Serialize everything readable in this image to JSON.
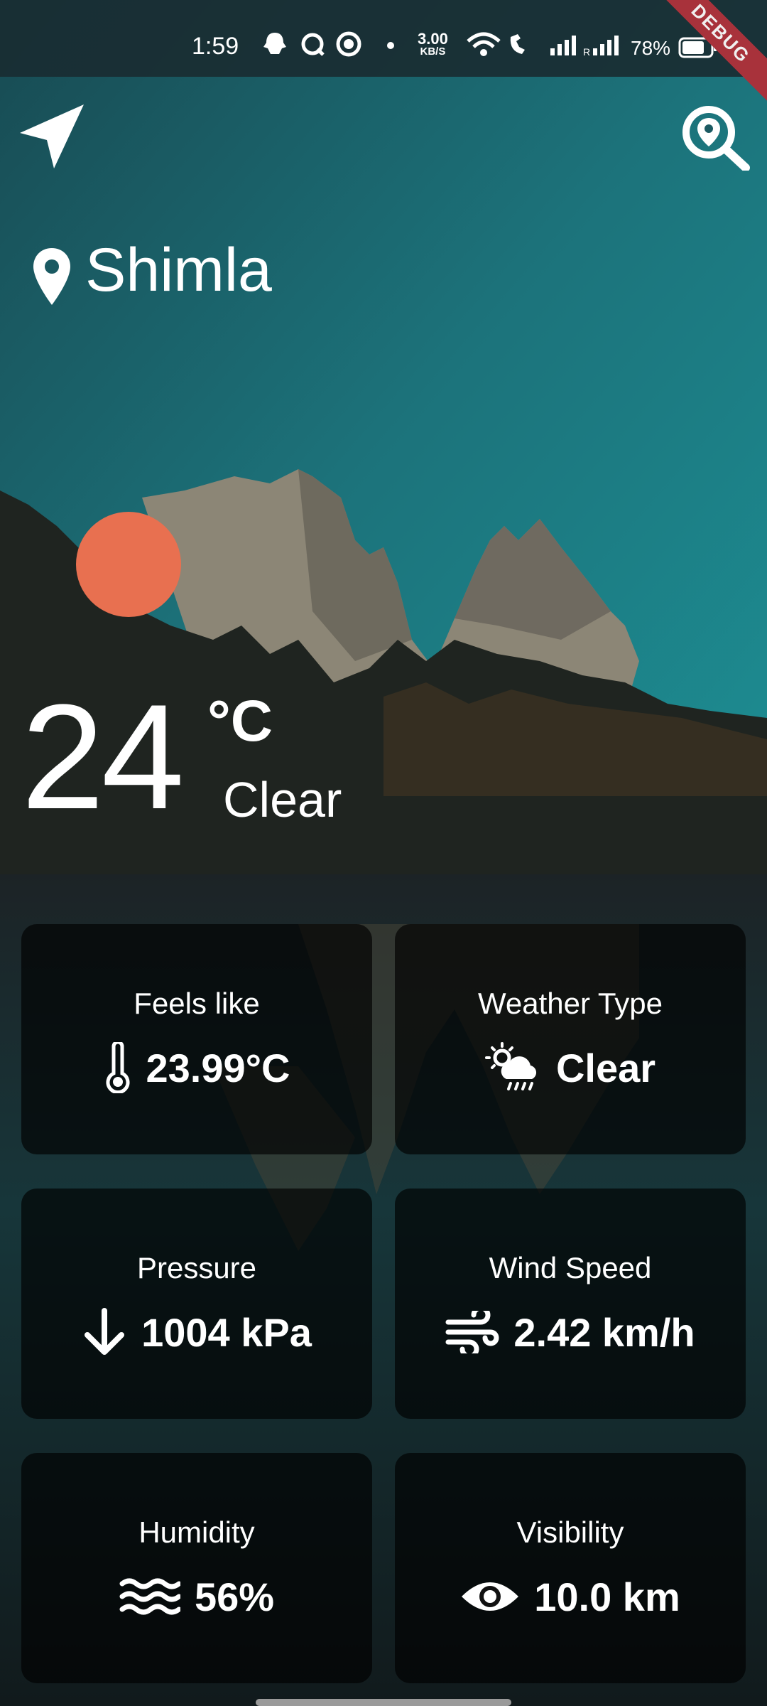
{
  "status_bar": {
    "time": "1:59",
    "net_speed": "3.00",
    "net_unit": "KB/S",
    "battery": "78%",
    "debug_label": "DEBUG"
  },
  "header": {
    "location_icon": "navigation-arrow-icon",
    "search_icon": "location-search-icon"
  },
  "location": {
    "city": "Shimla"
  },
  "current": {
    "temperature": "24",
    "unit": "°C",
    "condition": "Clear"
  },
  "cards": [
    {
      "label": "Feels like",
      "value": "23.99°C",
      "icon": "thermometer-icon"
    },
    {
      "label": "Weather Type",
      "value": "Clear",
      "icon": "sun-cloud-rain-icon"
    },
    {
      "label": "Pressure",
      "value": "1004 kPa",
      "icon": "arrow-down-icon"
    },
    {
      "label": "Wind Speed",
      "value": "2.42 km/h",
      "icon": "wind-icon"
    },
    {
      "label": "Humidity",
      "value": "56%",
      "icon": "waves-icon"
    },
    {
      "label": "Visibility",
      "value": "10.0 km",
      "icon": "eye-icon"
    }
  ],
  "colors": {
    "sun": "#e87050",
    "sky": "#1f7f86",
    "card": "#000000",
    "debug": "#a8323b"
  }
}
